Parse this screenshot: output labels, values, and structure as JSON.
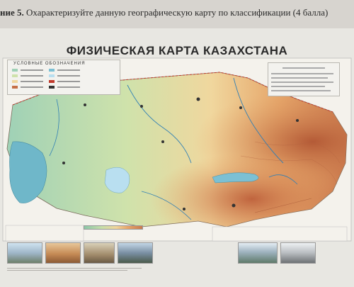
{
  "task": {
    "number_label": "ние 5.",
    "text": " Охарактеризуйте данную географическую карту по классификации (4 балла)"
  },
  "map": {
    "title": "ФИЗИЧЕСКАЯ КАРТА КАЗАХСТАНА",
    "legend_title": "УСЛОВНЫЕ  ОБОЗНАЧЕНИЯ",
    "colors": {
      "lowland": "#9fd1b6",
      "plain": "#cfe2ab",
      "upland": "#f0d79e",
      "highland": "#e6a66a",
      "mountain": "#c56f46",
      "water": "#6fb7c9",
      "lake_salt": "#b9dff0"
    }
  },
  "photos": {
    "icons": [
      "mountain-photo-icon",
      "desert-photo-icon",
      "animal-photo-icon",
      "mountain-lake-photo-icon",
      "mountain-river-photo-icon",
      "wolf-photo-icon"
    ]
  }
}
